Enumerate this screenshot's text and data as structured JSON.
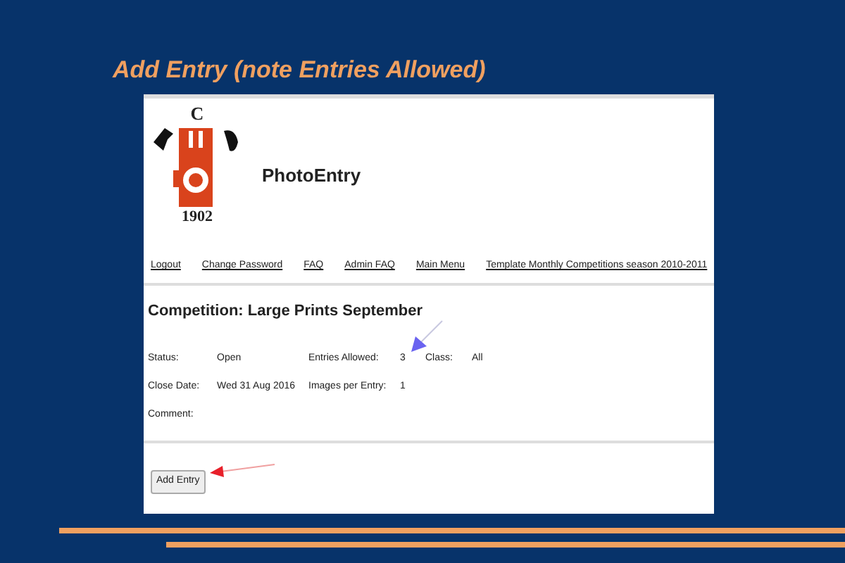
{
  "slide_title": "Add Entry (note Entries Allowed)",
  "logo": {
    "letter": "C",
    "year": "1902"
  },
  "site_title": "PhotoEntry",
  "nav_links": [
    "Logout",
    "Change Password",
    "FAQ",
    "Admin FAQ",
    "Main Menu",
    "Template Monthly Competitions season 2010-2011"
  ],
  "competition_heading": "Competition: Large Prints September",
  "details": [
    [
      {
        "label": "Status:",
        "value": "Open"
      },
      {
        "label": "Entries Allowed:",
        "value": "3"
      },
      {
        "label": "Class:",
        "value": "All"
      }
    ],
    [
      {
        "label": "Close Date:",
        "value": "Wed 31 Aug 2016"
      },
      {
        "label": "Images per Entry:",
        "value": "1"
      }
    ],
    [
      {
        "label": "Comment:"
      }
    ]
  ],
  "button": "Add Entry"
}
